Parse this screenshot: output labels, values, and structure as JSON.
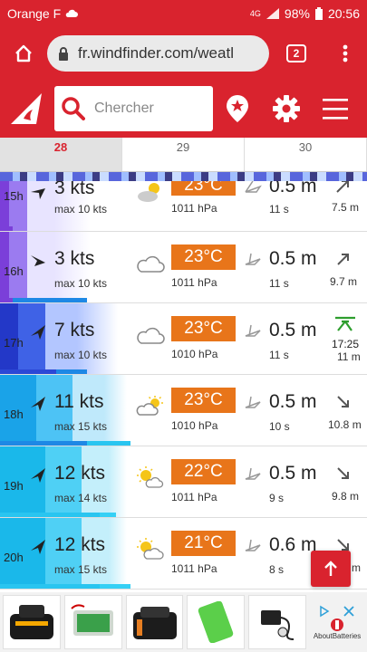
{
  "status": {
    "carrier": "Orange F",
    "network": "4G",
    "battery": "98%",
    "time": "20:56"
  },
  "browser": {
    "url": "fr.windfinder.com/weatl",
    "tab_count": "2"
  },
  "header": {
    "search_placeholder": "Chercher"
  },
  "days": [
    {
      "label": "28"
    },
    {
      "label": "29"
    },
    {
      "label": "30"
    }
  ],
  "rows": [
    {
      "hour": "15h",
      "speed": "3 kts",
      "max": "max 10 kts",
      "temp": "23°C",
      "pressure": "1011 hPa",
      "wave": "0.5 m",
      "period": "11 s",
      "tide": "7.5 m"
    },
    {
      "hour": "16h",
      "speed": "3 kts",
      "max": "max 10 kts",
      "temp": "23°C",
      "pressure": "1011 hPa",
      "wave": "0.5 m",
      "period": "11 s",
      "tide": "9.7 m"
    },
    {
      "hour": "17h",
      "speed": "7 kts",
      "max": "max 10 kts",
      "temp": "23°C",
      "pressure": "1010 hPa",
      "wave": "0.5 m",
      "period": "11 s",
      "tide_time": "17:25",
      "tide": "11 m"
    },
    {
      "hour": "18h",
      "speed": "11 kts",
      "max": "max 15 kts",
      "temp": "23°C",
      "pressure": "1010 hPa",
      "wave": "0.5 m",
      "period": "10 s",
      "tide": "10.8 m"
    },
    {
      "hour": "19h",
      "speed": "12 kts",
      "max": "max 14 kts",
      "temp": "22°C",
      "pressure": "1011 hPa",
      "wave": "0.5 m",
      "period": "9 s",
      "tide": "9.8 m"
    },
    {
      "hour": "20h",
      "speed": "12 kts",
      "max": "max 15 kts",
      "temp": "21°C",
      "pressure": "1011 hPa",
      "wave": "0.6 m",
      "period": "8 s",
      "tide": "m"
    }
  ],
  "ad": {
    "brand": "AboutBatteries"
  }
}
